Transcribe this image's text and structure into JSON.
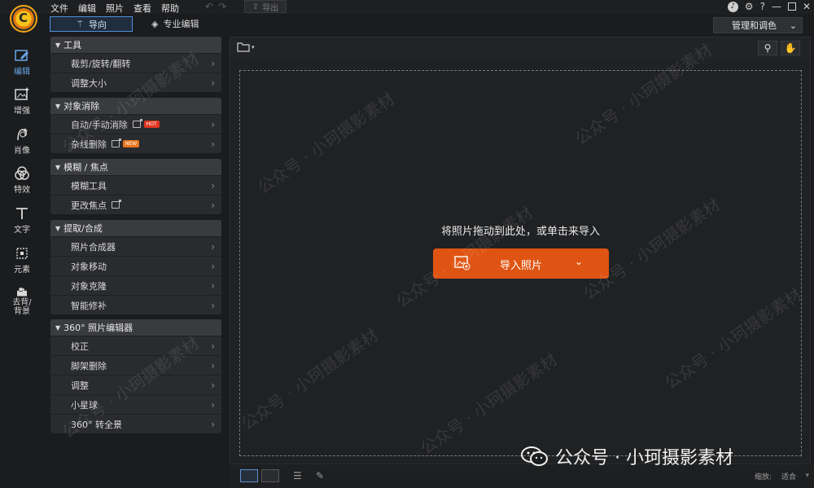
{
  "app": {
    "logo_glyph": "C"
  },
  "menu": {
    "items": [
      "文件",
      "编辑",
      "照片",
      "查看",
      "帮助"
    ],
    "export_label": "导出"
  },
  "window": {
    "help_label": "?",
    "bell_label": "♪",
    "minimize_label": "—",
    "close_label": "✕"
  },
  "modes": {
    "guide_label": "导向",
    "pro_label": "专业编辑",
    "manage_label": "管理和调色"
  },
  "rail": {
    "items": [
      {
        "label": "编辑",
        "icon": "edit-icon",
        "active": true
      },
      {
        "label": "增强",
        "icon": "enhance-icon"
      },
      {
        "label": "肖像",
        "icon": "portrait-icon"
      },
      {
        "label": "特效",
        "icon": "effects-icon"
      },
      {
        "label": "文字",
        "icon": "text-icon"
      },
      {
        "label": "元素",
        "icon": "elements-icon"
      },
      {
        "label": "去背/背景",
        "icon": "background-removal-icon",
        "line1": "去背/",
        "line2": "背景"
      }
    ]
  },
  "panel": {
    "groups": [
      {
        "title": "工具",
        "rows": [
          "裁剪/旋转/翻转",
          "调整大小"
        ]
      },
      {
        "title": "对象消除",
        "rows": [
          "自动/手动消除",
          "杂线删除"
        ],
        "badges": [
          "HOT",
          "NEW"
        ]
      },
      {
        "title": "模糊 / 焦点",
        "rows": [
          "模糊工具",
          "更改焦点"
        ]
      },
      {
        "title": "提取/合成",
        "rows": [
          "照片合成器",
          "对象移动",
          "对象克隆",
          "智能修补"
        ]
      },
      {
        "title": "360° 照片编辑器",
        "rows": [
          "校正",
          "脚架删除",
          "调整",
          "小星球",
          "360° 转全景"
        ]
      }
    ]
  },
  "workspace": {
    "drop_text": "将照片拖动到此处，或单击来导入",
    "import_label": "导入照片"
  },
  "bottombar": {
    "zoom_label": "缩放:",
    "zoom_value": "适合"
  },
  "watermark": {
    "text": "公众号 · 小珂摄影素材",
    "brand_text": "公众号 · 小珂摄影素材"
  },
  "colors": {
    "accent_orange": "#df5412",
    "accent_blue": "#4f8fd9",
    "panel_bg": "#2a2b2e",
    "app_bg": "#1b1c1e"
  }
}
